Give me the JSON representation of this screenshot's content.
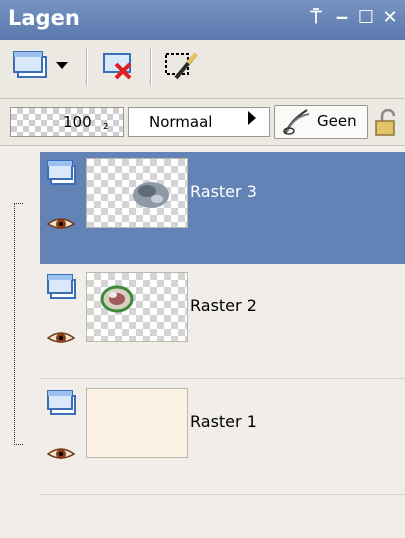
{
  "window": {
    "title": "Lagen",
    "pin_glyph": "⍑",
    "minimize_glyph": "‒",
    "maximize_glyph": "☐",
    "close_glyph": "✕"
  },
  "toolbar": {
    "new_layer_icon": "new-raster-layer-icon",
    "dropdown_icon": "chevron-down-icon",
    "delete_icon": "delete-layer-icon",
    "selection_icon": "selection-to-layer-icon"
  },
  "properties": {
    "opacity": "100",
    "opacity_spin": "₂",
    "blend_mode": "Normaal",
    "mask_label": "Geen"
  },
  "layers": [
    {
      "name": "Raster 3",
      "selected": true
    },
    {
      "name": "Raster 2",
      "selected": false
    },
    {
      "name": "Raster 1",
      "selected": false
    }
  ],
  "colors": {
    "titlebar": "#6b89bf",
    "selected_row": "#6382b6",
    "panel_bg": "#f1eee9"
  }
}
